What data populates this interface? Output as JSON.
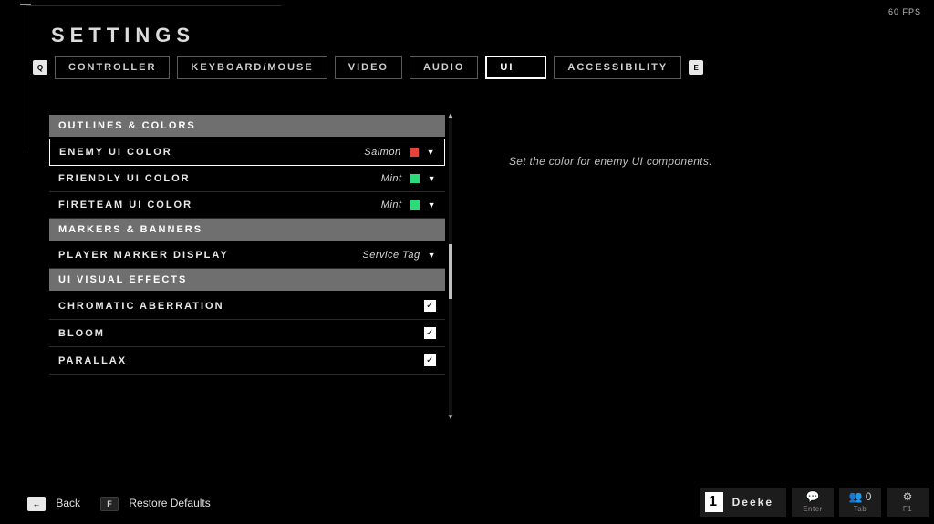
{
  "fps": "60 FPS",
  "title": "SETTINGS",
  "bumpers": {
    "left": "Q",
    "right": "E"
  },
  "tabs": [
    "CONTROLLER",
    "KEYBOARD/MOUSE",
    "VIDEO",
    "AUDIO",
    "UI",
    "ACCESSIBILITY"
  ],
  "active_tab": "UI",
  "categories": {
    "outlines": "OUTLINES & COLORS",
    "markers": "MARKERS & BANNERS",
    "vfx": "UI VISUAL EFFECTS"
  },
  "rows": {
    "enemy": {
      "label": "ENEMY UI COLOR",
      "value": "Salmon",
      "swatch": "#e2443b"
    },
    "friendly": {
      "label": "FRIENDLY UI COLOR",
      "value": "Mint",
      "swatch": "#2bdc7a"
    },
    "fireteam": {
      "label": "FIRETEAM UI COLOR",
      "value": "Mint",
      "swatch": "#2bdc7a"
    },
    "marker": {
      "label": "PLAYER MARKER DISPLAY",
      "value": "Service Tag"
    },
    "chroma": {
      "label": "CHROMATIC ABERRATION",
      "checked": true
    },
    "bloom": {
      "label": "BLOOM",
      "checked": true
    },
    "parallax": {
      "label": "PARALLAX",
      "checked": true
    }
  },
  "help_text": "Set the color for enemy UI components.",
  "footer": {
    "back_key": "←",
    "back_label": "Back",
    "restore_key": "F",
    "restore_label": "Restore Defaults"
  },
  "profile": {
    "icon": "1",
    "name": "Deeke"
  },
  "social": {
    "chat_key": "Enter",
    "fireteam_count": "0",
    "fireteam_key": "Tab",
    "settings_key": "F1"
  }
}
